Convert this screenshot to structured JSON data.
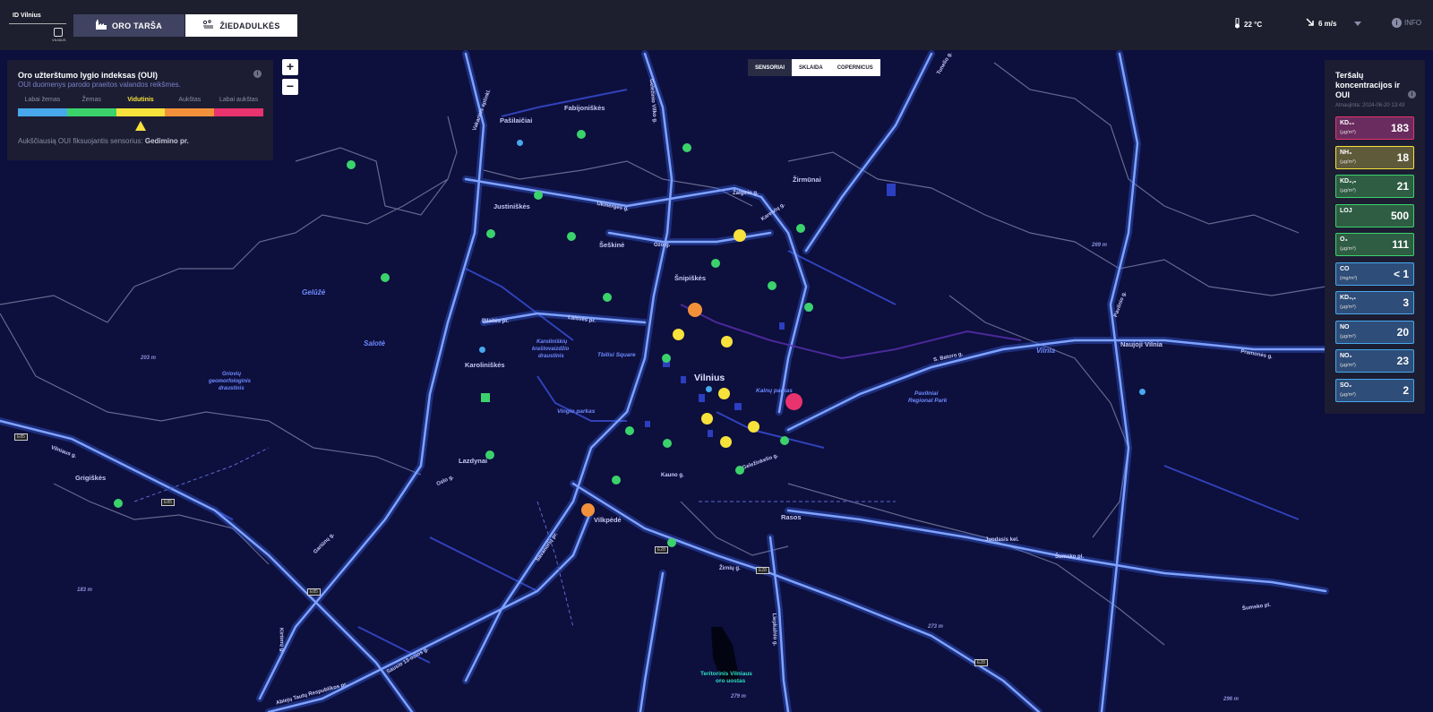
{
  "app": {
    "logo_text": "ID Vilnius",
    "logo_subtext": "VILNIUS"
  },
  "nav": {
    "tab_oro": {
      "label": "ORO TARŠA",
      "active": true
    },
    "tab_ziedadulkes": {
      "label": "ŽIEDADULKĖS",
      "active": false
    }
  },
  "weather": {
    "temperature": "22 °C",
    "wind": "6 m/s"
  },
  "info_label": "INFO",
  "zoom": {
    "in": "+",
    "out": "−"
  },
  "oui_panel": {
    "title": "Oro užterštumo lygio indeksas (OUI)",
    "subtitle": "OUI duomenys parodo praeitos valandos reikšmes.",
    "info_icon": "i",
    "levels": [
      {
        "label": "Labai žemas",
        "color": "#47a8ec"
      },
      {
        "label": "Žemas",
        "color": "#3bd26c"
      },
      {
        "label": "Vidutinis",
        "color": "#f7e23c"
      },
      {
        "label": "Aukštas",
        "color": "#f2913a"
      },
      {
        "label": "Labai aukštas",
        "color": "#e8336e"
      }
    ],
    "current_level": "Vidutinis",
    "sensor_text": "Aukščiausią OUI fiksuojantis sensorius:",
    "sensor_name": "Gedimino pr."
  },
  "source_tabs": [
    {
      "label": "SENSORIAI",
      "active": true
    },
    {
      "label": "SKLAIDA",
      "active": false
    },
    {
      "label": "COPERNICUS",
      "active": false
    }
  ],
  "pollutants_panel": {
    "title": "Teršalų koncentracijos ir OUI",
    "info_icon": "i",
    "updated": "Atnaujinta: 2024-06-20 13:43",
    "items": [
      {
        "name": "KD₁₀",
        "unit": "(µg/m³)",
        "value": "183",
        "border": "#e8336e",
        "bg": "#6a2c5e"
      },
      {
        "name": "NH₃",
        "unit": "(µg/m³)",
        "value": "18",
        "border": "#f7e23c",
        "bg": "#5e5a3a"
      },
      {
        "name": "KD₂,₅",
        "unit": "(µg/m³)",
        "value": "21",
        "border": "#3bd26c",
        "bg": "#2e5d43"
      },
      {
        "name": "LOJ",
        "unit": "",
        "value": "500",
        "border": "#3bd26c",
        "bg": "#2e5d43"
      },
      {
        "name": "O₃",
        "unit": "(µg/m³)",
        "value": "111",
        "border": "#3bd26c",
        "bg": "#2e5d43"
      },
      {
        "name": "CO",
        "unit": "(mg/m³)",
        "value": "< 1",
        "border": "#47a8ec",
        "bg": "#2e4d78"
      },
      {
        "name": "KD₀,₁",
        "unit": "(µg/m³)",
        "value": "3",
        "border": "#47a8ec",
        "bg": "#2e4d78"
      },
      {
        "name": "NO",
        "unit": "(µg/m³)",
        "value": "20",
        "border": "#47a8ec",
        "bg": "#2e4d78"
      },
      {
        "name": "NO₂",
        "unit": "(µg/m³)",
        "value": "23",
        "border": "#47a8ec",
        "bg": "#2e4d78"
      },
      {
        "name": "SO₂",
        "unit": "(µg/m³)",
        "value": "2",
        "border": "#47a8ec",
        "bg": "#2e4d78"
      }
    ]
  },
  "map": {
    "places": {
      "vilnius": "Vilnius",
      "pasilaiciai": "Pašilaičiai",
      "fabijoniskes": "Fabijoniškės",
      "justiniskes": "Justiniškės",
      "seskine": "Šeškinė",
      "zirmunai": "Žirmūnai",
      "snipiskes": "Šnipiškės",
      "karoliniskes": "Karoliniškės",
      "karoliniskiu_1": "Karoliniškių",
      "karoliniskiu_2": "kraštovaizdžio",
      "karoliniskiu_3": "draustinis",
      "tbilisi": "Tbilisi Square",
      "vingio": "Vingio parkas",
      "kalnu": "Kalnų parkas",
      "lazdynai": "Lazdynai",
      "grigiskes": "Grigiškės",
      "vilkpede": "Vilkpėdė",
      "rasos": "Rasos",
      "naujoji_vilnia": "Naujoji Vilnia",
      "pavilniai_1": "Pavilniai",
      "pavilniai_2": "Regional Park",
      "griovy_1": "Griovių",
      "griovy_2": "geomorfologinis",
      "griovy_3": "draustinis",
      "gelize": "Gelūžė",
      "salote": "Salotė",
      "vilnia_river": "Vilnia",
      "teritorinis_1": "Teritorinis Vilniaus",
      "teritorinis_2": "oro uostas"
    },
    "elevations": {
      "e203": "203 m",
      "e183": "183 m",
      "e269": "269 m",
      "e273": "273 m",
      "e279": "279 m",
      "e296": "296 m"
    },
    "roads": {
      "zalgirio": "Žalgirio g.",
      "ozo": "Ozo g.",
      "karaliaus": "Kareivių g.",
      "vilniaus": "Vilniaus g.",
      "ukmerges": "Ukmergės g.",
      "pilaites": "Pilaitės pr.",
      "konstitucijos": "Laisvės pr.",
      "gelezinio": "Geležinio Vilko g.",
      "batoro": "S. Batoro g.",
      "pramones": "Pramonės g.",
      "juodasis": "Juodasis kel.",
      "sumsko": "Šumsko pl.",
      "zirniu": "Žirnių g.",
      "liepkalnio": "Liepkalnio g.",
      "kirtimu": "Kirtimų g.",
      "savanoriu": "Savanorių pr.",
      "gariunu": "Gariūnų g.",
      "oslo": "Oslo g.",
      "kauno": "Kauno g.",
      "grazes": "Geležinkelio g.",
      "vakarinis": "Vakarinis aplinkl.",
      "vilniaus_g": "Vilniaus g.",
      "laisves": "Laisvės pr.",
      "tautu": "Abiejų Tautų Respublikos pr.",
      "jovariskiu": "Tunelio g.",
      "pavilnio": "Pavilnio g.",
      "sausio": "Sausio 13-osios g."
    },
    "shields": {
      "e85a": "E85",
      "e85b": "E85",
      "e85c": "E85",
      "e28a": "E28",
      "e28b": "E28",
      "e28c": "E28"
    }
  }
}
